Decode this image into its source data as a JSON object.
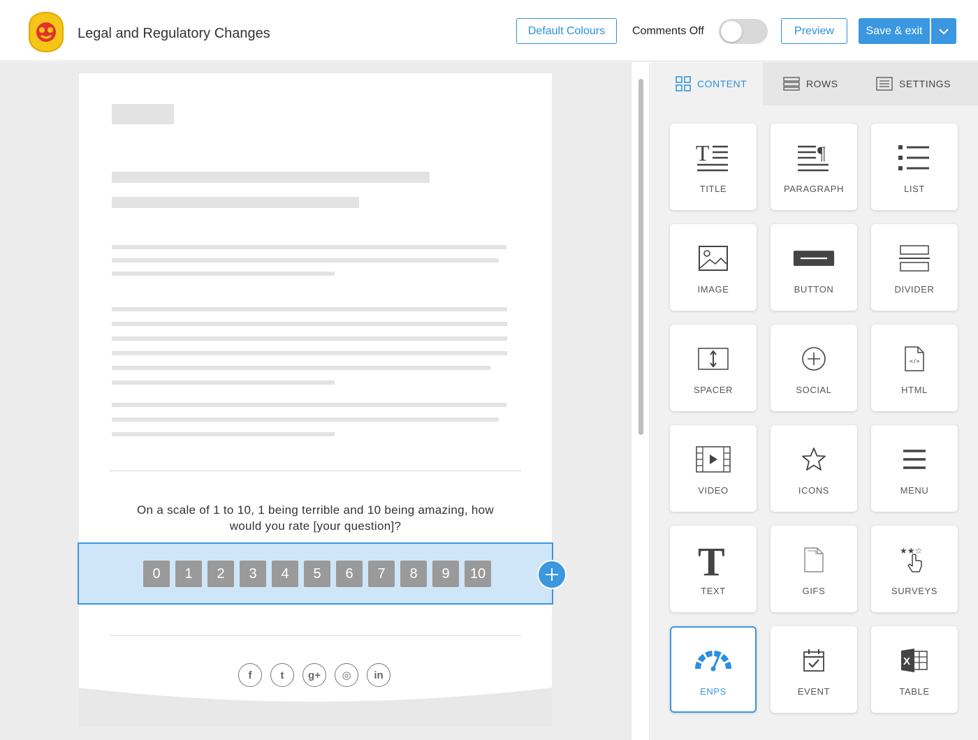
{
  "header": {
    "title": "Legal and Regulatory Changes",
    "default_colours_label": "Default Colours",
    "comments_label": "Comments Off",
    "comments_enabled": false,
    "preview_label": "Preview",
    "save_label": "Save & exit"
  },
  "canvas": {
    "question": "On a scale of 1 to 10, 1 being terrible and 10 being amazing, how would you rate [your question]?",
    "rating_options": [
      "0",
      "1",
      "2",
      "3",
      "4",
      "5",
      "6",
      "7",
      "8",
      "9",
      "10"
    ],
    "social_icons": [
      "facebook-icon",
      "twitter-icon",
      "google-plus-icon",
      "instagram-icon",
      "linkedin-icon"
    ],
    "social_glyphs": [
      "f",
      "t",
      "g+",
      "◎",
      "in"
    ]
  },
  "panel": {
    "tabs": [
      {
        "label": "CONTENT",
        "active": true
      },
      {
        "label": "ROWS",
        "active": false
      },
      {
        "label": "SETTINGS",
        "active": false
      }
    ],
    "tiles": [
      {
        "label": "TITLE",
        "icon": "title-icon"
      },
      {
        "label": "PARAGRAPH",
        "icon": "paragraph-icon"
      },
      {
        "label": "LIST",
        "icon": "list-icon"
      },
      {
        "label": "IMAGE",
        "icon": "image-icon"
      },
      {
        "label": "BUTTON",
        "icon": "button-icon"
      },
      {
        "label": "DIVIDER",
        "icon": "divider-icon"
      },
      {
        "label": "SPACER",
        "icon": "spacer-icon"
      },
      {
        "label": "SOCIAL",
        "icon": "social-icon"
      },
      {
        "label": "HTML",
        "icon": "html-icon"
      },
      {
        "label": "VIDEO",
        "icon": "video-icon"
      },
      {
        "label": "ICONS",
        "icon": "star-icon"
      },
      {
        "label": "MENU",
        "icon": "menu-icon"
      },
      {
        "label": "TEXT",
        "icon": "text-icon"
      },
      {
        "label": "GIFS",
        "icon": "gif-icon"
      },
      {
        "label": "SURVEYS",
        "icon": "surveys-icon"
      },
      {
        "label": "ENPS",
        "icon": "gauge-icon",
        "active": true
      },
      {
        "label": "EVENT",
        "icon": "calendar-icon"
      },
      {
        "label": "TABLE",
        "icon": "excel-icon"
      }
    ]
  },
  "colors": {
    "accent": "#3a97e0",
    "rating_button": "#9a9a9a",
    "selection_fill": "#cfe6f9",
    "logo_yellow": "#f5c518",
    "logo_red": "#e2322b"
  }
}
